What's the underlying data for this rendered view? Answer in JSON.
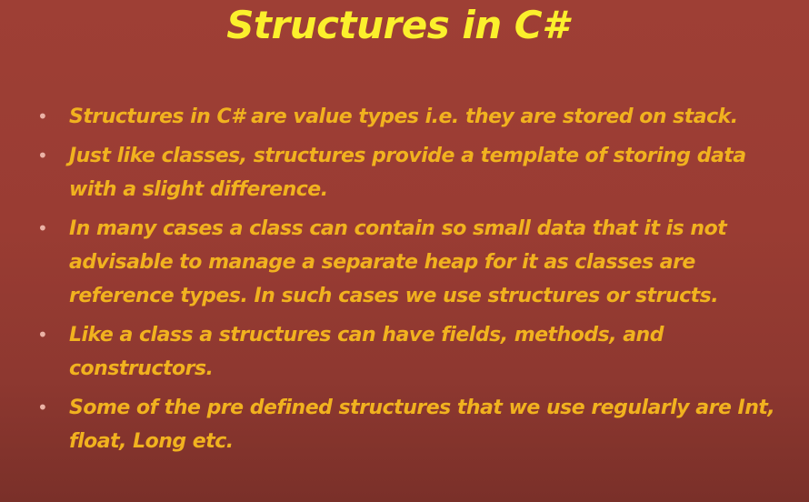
{
  "slide": {
    "title": "Structures in C#",
    "bullets": [
      {
        "text": "Structures in C# are value types i.e. they are stored on stack."
      },
      {
        "text": "Just like classes, structures provide a template of storing data with a slight difference."
      },
      {
        "text": "In many cases a class can contain so small data that it is not advisable to manage a separate heap for it as classes are reference types. In such cases we use structures or structs."
      },
      {
        "text": "Like a class a structures can have fields, methods, and constructors."
      },
      {
        "text": "Some of the pre defined structures that we use regularly are Int, float, Long etc."
      }
    ],
    "bullet_glyph": "•",
    "colors": {
      "background": "#9b3d34",
      "title": "#fbf02c",
      "body_text": "#f1b21f",
      "bullet": "#ebb3a6"
    }
  }
}
